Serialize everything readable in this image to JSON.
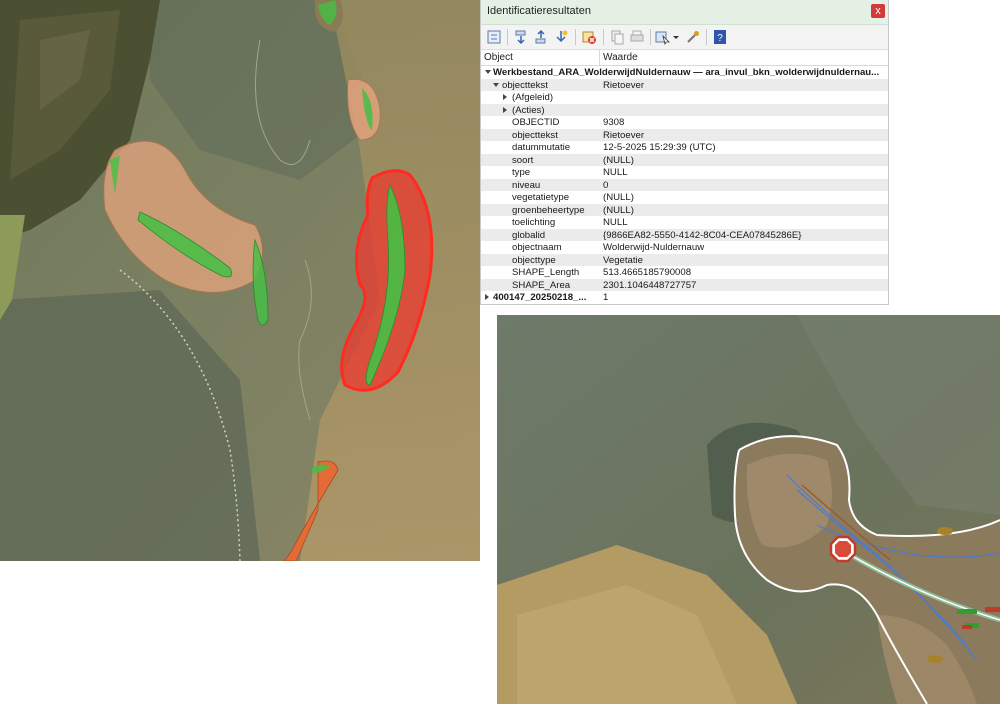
{
  "panel": {
    "title": "Identificatieresultaten",
    "close_label": "x",
    "columns": {
      "object": "Object",
      "value": "Waarde"
    },
    "toolbar_icons": [
      "expand-tree-icon",
      "expand-all-icon",
      "collapse-all-icon",
      "expand-new-icon",
      "clear-results-icon",
      "copy-feature-icon",
      "print-icon",
      "identify-mode-icon",
      "dropdown-arrow-icon",
      "settings-icon",
      "help-icon"
    ],
    "layer_label": "Werkbestand_ARA_WolderwijdNuldernauw — ara_invul_bkn_wolderwijdnuldernau...",
    "feature": {
      "key": "objecttekst",
      "value": "Rietoever"
    },
    "groups": [
      "(Afgeleid)",
      "(Acties)"
    ],
    "attributes": [
      {
        "key": "OBJECTID",
        "value": "9308"
      },
      {
        "key": "objecttekst",
        "value": "Rietoever"
      },
      {
        "key": "datummutatie",
        "value": "12-5-2025 15:29:39 (UTC)"
      },
      {
        "key": "soort",
        "value": "(NULL)"
      },
      {
        "key": "type",
        "value": "NULL"
      },
      {
        "key": "niveau",
        "value": "0"
      },
      {
        "key": "vegetatietype",
        "value": "(NULL)"
      },
      {
        "key": "groenbeheertype",
        "value": "(NULL)"
      },
      {
        "key": "toelichting",
        "value": "NULL"
      },
      {
        "key": "globalid",
        "value": "{9866EA82-5550-4142-8C04-CEA07845286E}"
      },
      {
        "key": "objectnaam",
        "value": "Wolderwijd-Nuldernauw"
      },
      {
        "key": "objecttype",
        "value": "Vegetatie"
      },
      {
        "key": "SHAPE_Length",
        "value": "513.4665185790008"
      },
      {
        "key": "SHAPE_Area",
        "value": "2301.1046448727757"
      }
    ],
    "second_layer": {
      "key": "400147_20250218_...",
      "value": "1"
    }
  },
  "colors": {
    "title_bar": "#e6f1e6",
    "reed_fill": "#e0a27c",
    "vegetation_green": "#44c044",
    "selection_red": "#ee3a2f",
    "orange_polygon": "#e46a36",
    "close_button": "#d23a3a"
  }
}
